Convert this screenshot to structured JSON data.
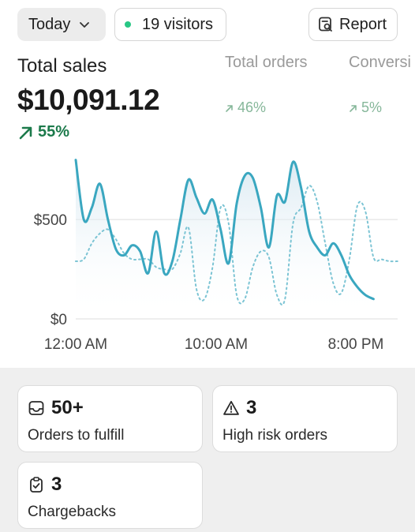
{
  "header": {
    "date_filter": "Today",
    "visitors": "19 visitors",
    "report_label": "Report"
  },
  "metrics": {
    "total_sales": {
      "label": "Total sales",
      "value": "$10,091.12",
      "trend": "55%",
      "trend_icon": "arrow-up-right-icon"
    },
    "total_orders": {
      "label": "Total orders",
      "trend": "46%"
    },
    "conversion": {
      "label": "Conversi",
      "trend": "5%"
    }
  },
  "chart_data": {
    "type": "line",
    "x_tick_labels": [
      "12:00 AM",
      "10:00 AM",
      "8:00 PM"
    ],
    "y_tick_labels": [
      "$500",
      "$0"
    ],
    "ylim": [
      0,
      850
    ],
    "x_range": [
      0,
      24
    ],
    "grid": true,
    "series": [
      {
        "style": "solid",
        "color": "#3aa7c0",
        "x": [
          0,
          0.6,
          1.2,
          1.8,
          2.4,
          3.0,
          3.6,
          4.2,
          4.8,
          5.4,
          6.0,
          6.6,
          7.2,
          7.8,
          8.4,
          9.0,
          9.6,
          10.2,
          10.8,
          11.4,
          12.0,
          12.6,
          13.2,
          13.8,
          14.4,
          15.0,
          15.6,
          16.2,
          16.8,
          17.4,
          18.0,
          18.6,
          19.2,
          19.8,
          20.4,
          21.0,
          21.6,
          22.2
        ],
        "values": [
          800,
          500,
          560,
          680,
          500,
          350,
          320,
          370,
          340,
          230,
          440,
          230,
          290,
          500,
          700,
          610,
          530,
          600,
          450,
          280,
          580,
          720,
          710,
          560,
          360,
          620,
          590,
          790,
          660,
          440,
          360,
          320,
          380,
          320,
          220,
          160,
          120,
          100
        ]
      },
      {
        "style": "dotted",
        "color": "#7cc4d4",
        "x": [
          0,
          0.6,
          1.2,
          1.8,
          2.4,
          3.0,
          3.6,
          4.2,
          4.8,
          5.4,
          6.0,
          6.6,
          7.2,
          7.8,
          8.4,
          9.0,
          9.6,
          10.2,
          10.8,
          11.4,
          12.0,
          12.6,
          13.2,
          13.8,
          14.4,
          15.0,
          15.6,
          16.2,
          16.8,
          17.4,
          18.0,
          18.6,
          19.2,
          19.8,
          20.4,
          21.0,
          21.6,
          22.2,
          22.8,
          23.4,
          24.0
        ],
        "values": [
          290,
          300,
          380,
          430,
          450,
          400,
          330,
          300,
          300,
          300,
          260,
          250,
          250,
          330,
          460,
          150,
          100,
          260,
          560,
          480,
          120,
          100,
          260,
          340,
          310,
          120,
          100,
          480,
          560,
          670,
          590,
          380,
          180,
          130,
          300,
          570,
          540,
          310,
          300,
          290,
          290
        ]
      }
    ]
  },
  "cards": [
    {
      "icon": "inbox-icon",
      "count": "50+",
      "label": "Orders to fulfill"
    },
    {
      "icon": "warning-icon",
      "count": "3",
      "label": "High risk orders"
    },
    {
      "icon": "clipboard-check-icon",
      "count": "3",
      "label": "Chargebacks"
    }
  ]
}
